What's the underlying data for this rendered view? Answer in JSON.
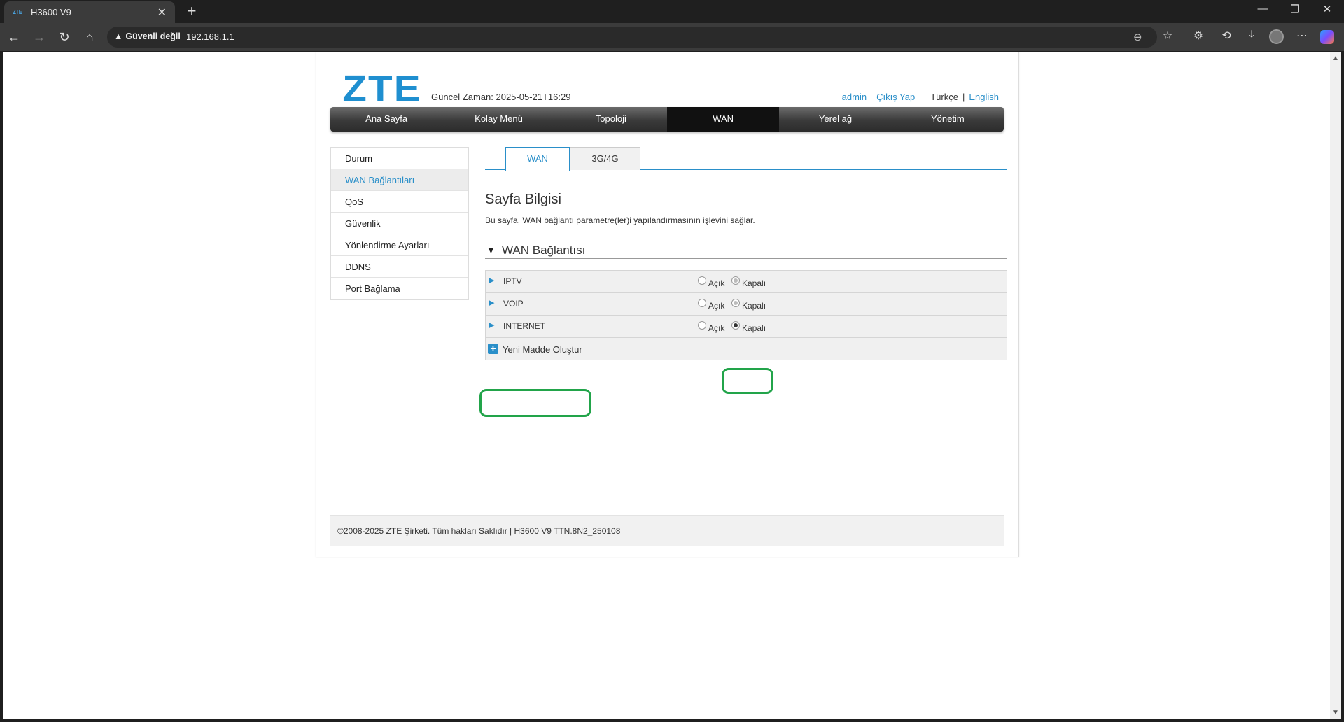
{
  "browser": {
    "tab_title": "H3600 V9",
    "tab_favicon": "ZTE",
    "security_label": "Güvenli değil",
    "url": "192.168.1.1"
  },
  "header": {
    "logo": "ZTE",
    "current_time": "Güncel Zaman: 2025-05-21T16:29",
    "user": "admin",
    "logout": "Çıkış Yap",
    "lang_tr": "Türkçe",
    "lang_sep": "|",
    "lang_en": "English"
  },
  "mainnav": [
    "Ana Sayfa",
    "Kolay Menü",
    "Topoloji",
    "WAN",
    "Yerel ağ",
    "Yönetim"
  ],
  "mainnav_active": "WAN",
  "sidebar": [
    "Durum",
    "WAN Bağlantıları",
    "QoS",
    "Güvenlik",
    "Yönlendirme Ayarları",
    "DDNS",
    "Port Bağlama"
  ],
  "sidebar_active": "WAN Bağlantıları",
  "subtabs": [
    "WAN",
    "3G/4G"
  ],
  "subtab_active": "WAN",
  "page": {
    "title": "Sayfa Bilgisi",
    "description": "Bu sayfa, WAN bağlantı parametre(ler)i yapılandırmasının işlevini sağlar.",
    "section_title": "WAN Bağlantısı"
  },
  "wan_connections": [
    {
      "name": "IPTV",
      "on_label": "Açık",
      "off_label": "Kapalı",
      "state": "off"
    },
    {
      "name": "VOIP",
      "on_label": "Açık",
      "off_label": "Kapalı",
      "state": "off"
    },
    {
      "name": "INTERNET",
      "on_label": "Açık",
      "off_label": "Kapalı",
      "state": "off"
    }
  ],
  "add_new_label": "Yeni Madde Oluştur",
  "footer": "©2008-2025 ZTE Şirketi. Tüm hakları Saklıdır  |   H3600 V9 TTN.8N2_250108",
  "colors": {
    "accent": "#2a8fc9",
    "highlight": "#22a44a",
    "nav_dark": "#2c2c2c"
  }
}
